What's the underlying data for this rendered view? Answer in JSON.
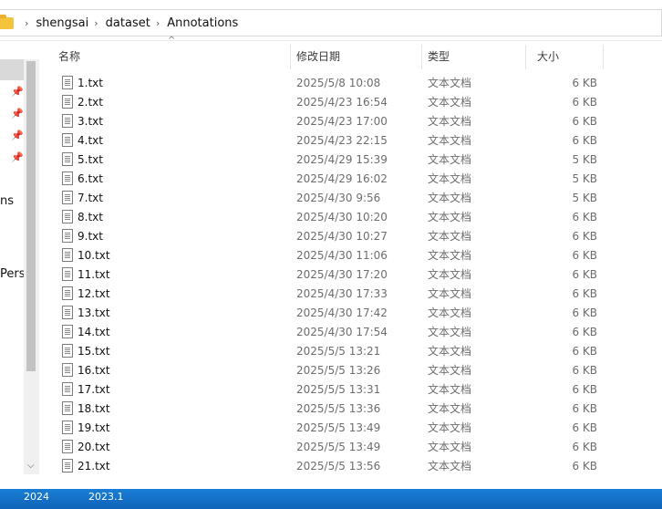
{
  "breadcrumb": [
    "shengsai",
    "dataset",
    "Annotations"
  ],
  "columns": {
    "name": "名称",
    "date": "修改日期",
    "type": "类型",
    "size": "大小"
  },
  "nav": {
    "partial_labels": [
      "ns",
      "Pers"
    ]
  },
  "files": [
    {
      "name": "1.txt",
      "date": "2025/5/8 10:08",
      "type": "文本文档",
      "size": "6 KB"
    },
    {
      "name": "2.txt",
      "date": "2025/4/23 16:54",
      "type": "文本文档",
      "size": "6 KB"
    },
    {
      "name": "3.txt",
      "date": "2025/4/23 17:00",
      "type": "文本文档",
      "size": "6 KB"
    },
    {
      "name": "4.txt",
      "date": "2025/4/23 22:15",
      "type": "文本文档",
      "size": "6 KB"
    },
    {
      "name": "5.txt",
      "date": "2025/4/29 15:39",
      "type": "文本文档",
      "size": "5 KB"
    },
    {
      "name": "6.txt",
      "date": "2025/4/29 16:02",
      "type": "文本文档",
      "size": "5 KB"
    },
    {
      "name": "7.txt",
      "date": "2025/4/30 9:56",
      "type": "文本文档",
      "size": "5 KB"
    },
    {
      "name": "8.txt",
      "date": "2025/4/30 10:20",
      "type": "文本文档",
      "size": "6 KB"
    },
    {
      "name": "9.txt",
      "date": "2025/4/30 10:27",
      "type": "文本文档",
      "size": "6 KB"
    },
    {
      "name": "10.txt",
      "date": "2025/4/30 11:06",
      "type": "文本文档",
      "size": "6 KB"
    },
    {
      "name": "11.txt",
      "date": "2025/4/30 17:20",
      "type": "文本文档",
      "size": "6 KB"
    },
    {
      "name": "12.txt",
      "date": "2025/4/30 17:33",
      "type": "文本文档",
      "size": "6 KB"
    },
    {
      "name": "13.txt",
      "date": "2025/4/30 17:42",
      "type": "文本文档",
      "size": "6 KB"
    },
    {
      "name": "14.txt",
      "date": "2025/4/30 17:54",
      "type": "文本文档",
      "size": "6 KB"
    },
    {
      "name": "15.txt",
      "date": "2025/5/5 13:21",
      "type": "文本文档",
      "size": "6 KB"
    },
    {
      "name": "16.txt",
      "date": "2025/5/5 13:26",
      "type": "文本文档",
      "size": "6 KB"
    },
    {
      "name": "17.txt",
      "date": "2025/5/5 13:31",
      "type": "文本文档",
      "size": "6 KB"
    },
    {
      "name": "18.txt",
      "date": "2025/5/5 13:36",
      "type": "文本文档",
      "size": "6 KB"
    },
    {
      "name": "19.txt",
      "date": "2025/5/5 13:49",
      "type": "文本文档",
      "size": "6 KB"
    },
    {
      "name": "20.txt",
      "date": "2025/5/5 13:49",
      "type": "文本文档",
      "size": "6 KB"
    },
    {
      "name": "21.txt",
      "date": "2025/5/5 13:56",
      "type": "文本文档",
      "size": "6 KB"
    }
  ],
  "taskbar": {
    "labels": [
      "2024",
      "2023.1"
    ]
  },
  "colors": {
    "taskbar": "#1172c9",
    "folder": "#f4c53c",
    "selected_nav": "#d9d9d9"
  }
}
